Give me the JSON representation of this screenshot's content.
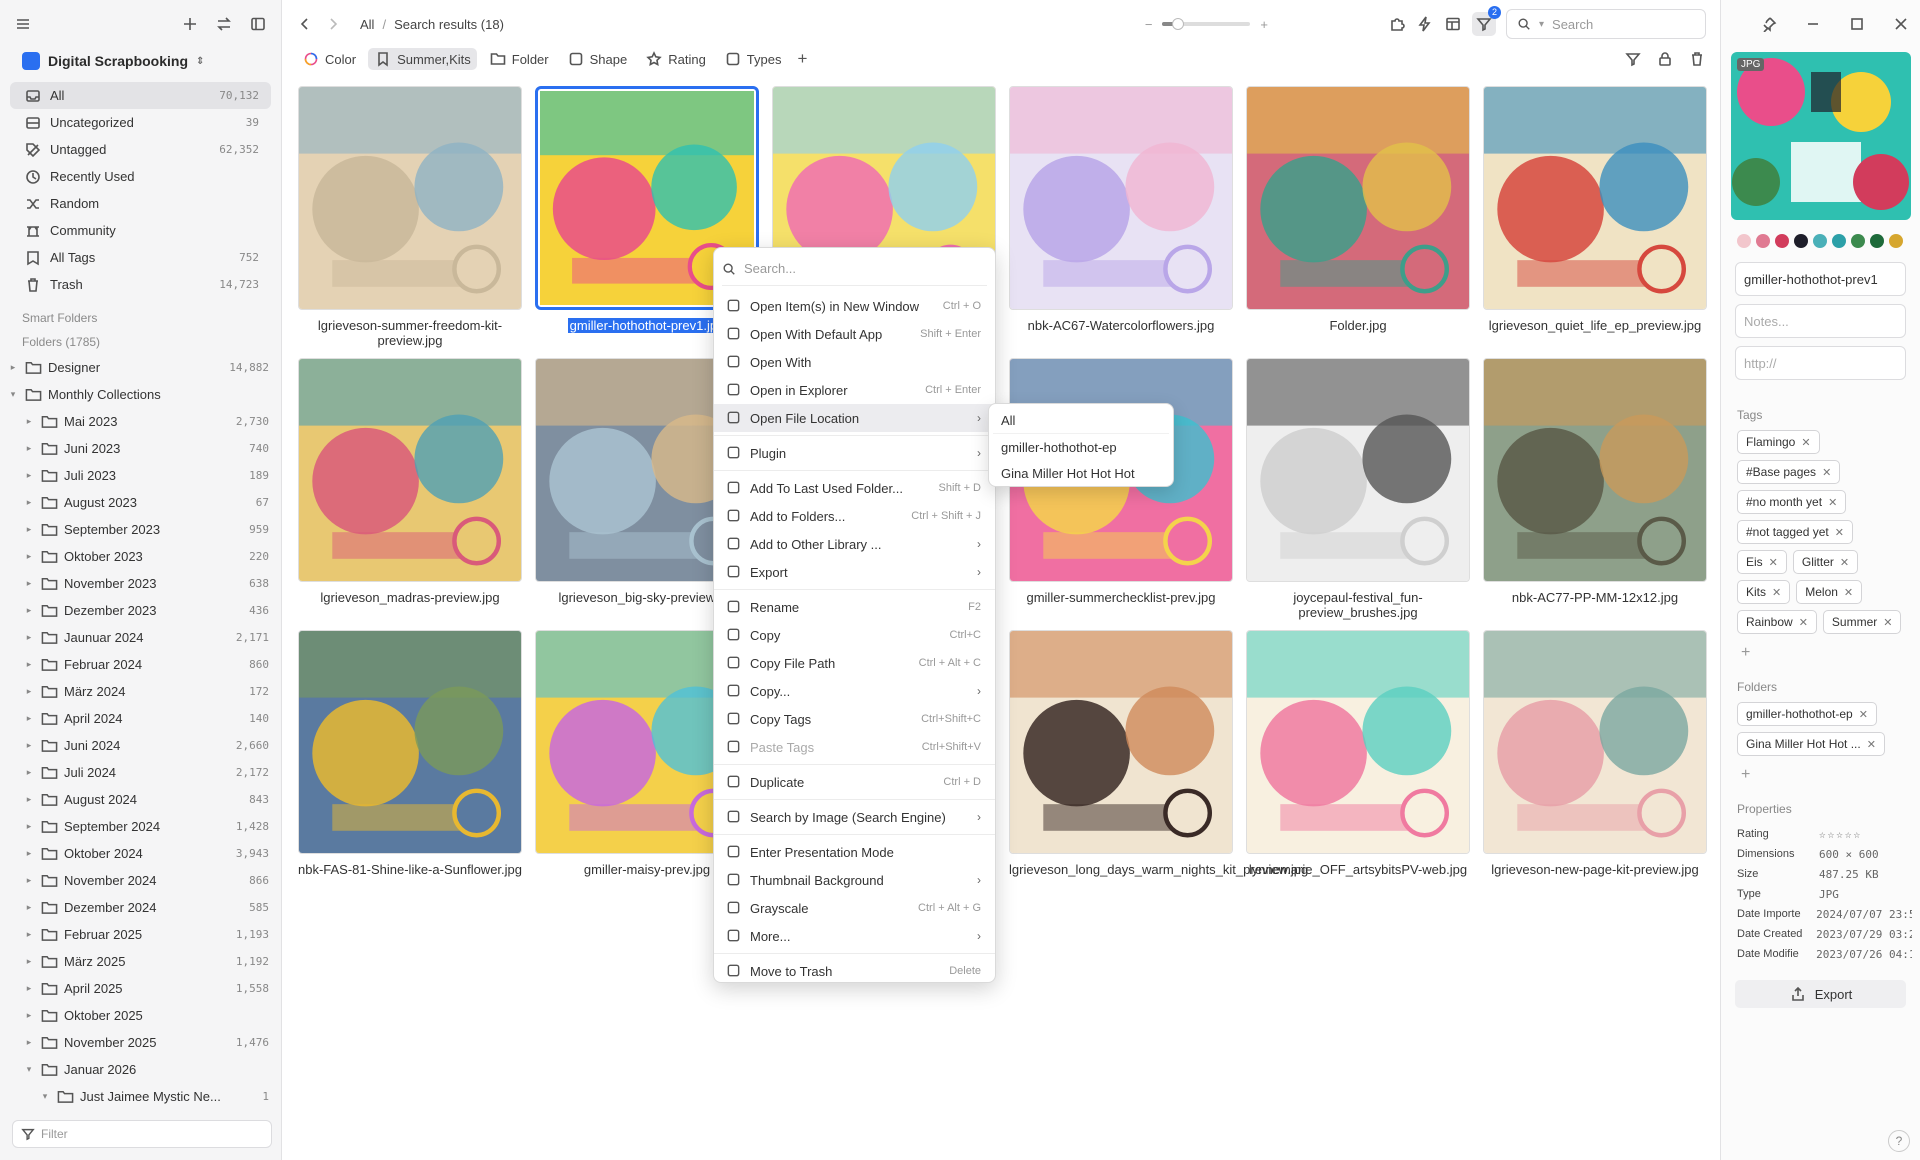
{
  "sidebar": {
    "library_name": "Digital Scrapbooking",
    "nav": [
      {
        "label": "All",
        "count": "70,132",
        "icon": "inbox-icon"
      },
      {
        "label": "Uncategorized",
        "count": "39",
        "icon": "uncategorized-icon"
      },
      {
        "label": "Untagged",
        "count": "62,352",
        "icon": "untagged-icon"
      },
      {
        "label": "Recently Used",
        "count": "",
        "icon": "clock-icon"
      },
      {
        "label": "Random",
        "count": "",
        "icon": "shuffle-icon"
      },
      {
        "label": "Community",
        "count": "",
        "icon": "community-icon"
      },
      {
        "label": "All Tags",
        "count": "752",
        "icon": "tag-icon"
      },
      {
        "label": "Trash",
        "count": "14,723",
        "icon": "trash-icon"
      }
    ],
    "smart_folders_label": "Smart Folders",
    "folders_label": "Folders (1785)",
    "folders": [
      {
        "label": "Designer",
        "count": "14,882",
        "depth": 0,
        "caret": "▸"
      },
      {
        "label": "Monthly Collections",
        "count": "",
        "depth": 0,
        "caret": "▾"
      },
      {
        "label": "Mai 2023",
        "count": "2,730",
        "depth": 1,
        "caret": "▸"
      },
      {
        "label": "Juni 2023",
        "count": "740",
        "depth": 1,
        "caret": "▸"
      },
      {
        "label": "Juli 2023",
        "count": "189",
        "depth": 1,
        "caret": "▸"
      },
      {
        "label": "August 2023",
        "count": "67",
        "depth": 1,
        "caret": "▸"
      },
      {
        "label": "September 2023",
        "count": "959",
        "depth": 1,
        "caret": "▸"
      },
      {
        "label": "Oktober 2023",
        "count": "220",
        "depth": 1,
        "caret": "▸"
      },
      {
        "label": "November 2023",
        "count": "638",
        "depth": 1,
        "caret": "▸"
      },
      {
        "label": "Dezember 2023",
        "count": "436",
        "depth": 1,
        "caret": "▸"
      },
      {
        "label": "Jaunuar 2024",
        "count": "2,171",
        "depth": 1,
        "caret": "▸"
      },
      {
        "label": "Februar 2024",
        "count": "860",
        "depth": 1,
        "caret": "▸"
      },
      {
        "label": "März 2024",
        "count": "172",
        "depth": 1,
        "caret": "▸"
      },
      {
        "label": "April 2024",
        "count": "140",
        "depth": 1,
        "caret": "▸"
      },
      {
        "label": "Juni 2024",
        "count": "2,660",
        "depth": 1,
        "caret": "▸"
      },
      {
        "label": "Juli 2024",
        "count": "2,172",
        "depth": 1,
        "caret": "▸"
      },
      {
        "label": "August 2024",
        "count": "843",
        "depth": 1,
        "caret": "▸"
      },
      {
        "label": "September 2024",
        "count": "1,428",
        "depth": 1,
        "caret": "▸"
      },
      {
        "label": "Oktober 2024",
        "count": "3,943",
        "depth": 1,
        "caret": "▸"
      },
      {
        "label": "November 2024",
        "count": "866",
        "depth": 1,
        "caret": "▸"
      },
      {
        "label": "Dezember 2024",
        "count": "585",
        "depth": 1,
        "caret": "▸"
      },
      {
        "label": "Februar 2025",
        "count": "1,193",
        "depth": 1,
        "caret": "▸"
      },
      {
        "label": "März 2025",
        "count": "1,192",
        "depth": 1,
        "caret": "▸"
      },
      {
        "label": "April 2025",
        "count": "1,558",
        "depth": 1,
        "caret": "▸"
      },
      {
        "label": "Oktober 2025",
        "count": "",
        "depth": 1,
        "caret": "▸"
      },
      {
        "label": "November 2025",
        "count": "1,476",
        "depth": 1,
        "caret": "▸"
      },
      {
        "label": "Januar 2026",
        "count": "",
        "depth": 1,
        "caret": "▾"
      },
      {
        "label": "Just Jaimee Mystic Ne...",
        "count": "1",
        "depth": 2,
        "caret": "▾"
      }
    ],
    "filter_placeholder": "Filter"
  },
  "toolbar": {
    "crumb_root": "All",
    "crumb_sep": "/",
    "crumb_current": "Search results (18)",
    "zoom_level": 0.18,
    "filter_badge": "2",
    "search_placeholder": "Search"
  },
  "filterbar": [
    {
      "label": "Color",
      "icon": "color-wheel-icon",
      "active": false
    },
    {
      "label": "Summer,Kits",
      "icon": "bookmark-icon",
      "active": true
    },
    {
      "label": "Folder",
      "icon": "folder-icon",
      "active": false
    },
    {
      "label": "Shape",
      "icon": "shape-icon",
      "active": false
    },
    {
      "label": "Rating",
      "icon": "star-icon",
      "active": false
    },
    {
      "label": "Types",
      "icon": "types-icon",
      "active": false
    }
  ],
  "grid": [
    {
      "name": "lgrieveson-summer-freedom-kit-preview.jpg",
      "c1": "#c9b89a",
      "c2": "#8fb3c4",
      "c3": "#e4d2b4"
    },
    {
      "name": "gmiller-hothothot-prev1.jpg",
      "c1": "#e94e8a",
      "c2": "#2fc0b0",
      "c3": "#f6d23a",
      "selected": true
    },
    {
      "name": "",
      "c1": "#f06fb0",
      "c2": "#8fd0f0",
      "c3": "#f5e06a"
    },
    {
      "name": "nbk-AC67-Watercolorflowers.jpg",
      "c1": "#b9a6e8",
      "c2": "#f0b5d2",
      "c3": "#e8e2f4"
    },
    {
      "name": "Folder.jpg",
      "c1": "#3e9e8a",
      "c2": "#e2c14a",
      "c3": "#d46a7a"
    },
    {
      "name": "lgrieveson_quiet_life_ep_preview.jpg",
      "c1": "#d6483e",
      "c2": "#3c8fbe",
      "c3": "#f0e3c4"
    },
    {
      "name": "lgrieveson_madras-preview.jpg",
      "c1": "#d95a7a",
      "c2": "#4fa0b4",
      "c3": "#e8c872"
    },
    {
      "name": "lgrieveson_big-sky-preview.jpg",
      "c1": "#a9c2d0",
      "c2": "#d9b98a",
      "c3": "#7f8fa0"
    },
    {
      "name": "",
      "c1": "#fff",
      "c2": "#fff",
      "c3": "#fff"
    },
    {
      "name": "gmiller-summerchecklist-prev.jpg",
      "c1": "#f4d34c",
      "c2": "#3cc0d0",
      "c3": "#f06fa2"
    },
    {
      "name": "joycepaul-festival_fun-preview_brushes.jpg",
      "c1": "#cfcfcf",
      "c2": "#555555",
      "c3": "#eeeeee"
    },
    {
      "name": "nbk-AC77-PP-MM-12x12.jpg",
      "c1": "#5a5a48",
      "c2": "#c99a5a",
      "c3": "#8ea08a"
    },
    {
      "name": "nbk-FAS-81-Shine-like-a-Sunflower.jpg",
      "c1": "#e8b830",
      "c2": "#7a9a5a",
      "c3": "#5a7aa0"
    },
    {
      "name": "gmiller-maisy-prev.jpg",
      "c1": "#c86adc",
      "c2": "#4fc0d8",
      "c3": "#f4d04a"
    },
    {
      "name": "",
      "c1": "#fff",
      "c2": "#fff",
      "c3": "#fff"
    },
    {
      "name": "lgrieveson_long_days_warm_nights_kit_preview.jpg",
      "c1": "#3a2a26",
      "c2": "#d08a5a",
      "c3": "#f0e4d0"
    },
    {
      "name": "lynnemarie_OFF_artsybitsPV-web.jpg",
      "c1": "#f07aa0",
      "c2": "#5ad0c0",
      "c3": "#f8f0e0"
    },
    {
      "name": "lgrieveson-new-page-kit-preview.jpg",
      "c1": "#e8a0a8",
      "c2": "#7aa8a0",
      "c3": "#f2e6d4"
    }
  ],
  "context_menu": {
    "search_placeholder": "Search...",
    "items": [
      {
        "label": "Open Item(s) in New Window",
        "sc": "Ctrl + O",
        "icon": "new-window-icon"
      },
      {
        "label": "Open With Default App",
        "sc": "Shift + Enter",
        "icon": "open-app-icon"
      },
      {
        "label": "Open With",
        "sc": "",
        "icon": "open-with-icon"
      },
      {
        "label": "Open in Explorer",
        "sc": "Ctrl + Enter",
        "icon": "explorer-icon"
      },
      {
        "label": "Open File Location",
        "sc": "",
        "icon": "folder-location-icon",
        "sub": true,
        "hover": true
      },
      {
        "sep": true
      },
      {
        "label": "Plugin",
        "sc": "",
        "icon": "plugin-icon",
        "sub": true
      },
      {
        "sep": true
      },
      {
        "label": "Add To Last Used Folder...",
        "sc": "Shift + D",
        "icon": "add-folder-icon"
      },
      {
        "label": "Add to Folders...",
        "sc": "Ctrl + Shift + J",
        "icon": "add-folders-icon"
      },
      {
        "label": "Add to Other Library ...",
        "sc": "",
        "icon": "library-icon",
        "sub": true
      },
      {
        "label": "Export",
        "sc": "",
        "icon": "export-icon",
        "sub": true
      },
      {
        "sep": true
      },
      {
        "label": "Rename",
        "sc": "F2",
        "icon": "rename-icon"
      },
      {
        "label": "Copy",
        "sc": "Ctrl+C",
        "icon": "copy-icon"
      },
      {
        "label": "Copy File Path",
        "sc": "Ctrl + Alt + C",
        "icon": "copy-path-icon"
      },
      {
        "label": "Copy...",
        "sc": "",
        "icon": "copy-more-icon",
        "sub": true
      },
      {
        "label": "Copy Tags",
        "sc": "Ctrl+Shift+C",
        "icon": "copy-tags-icon"
      },
      {
        "label": "Paste Tags",
        "sc": "Ctrl+Shift+V",
        "icon": "paste-tags-icon",
        "disabled": true
      },
      {
        "sep": true
      },
      {
        "label": "Duplicate",
        "sc": "Ctrl + D",
        "icon": "duplicate-icon"
      },
      {
        "sep": true
      },
      {
        "label": "Search by Image (Search Engine)",
        "sc": "",
        "icon": "image-search-icon",
        "sub": true
      },
      {
        "sep": true
      },
      {
        "label": "Enter Presentation Mode",
        "sc": "",
        "icon": "presentation-icon"
      },
      {
        "label": "Thumbnail Background",
        "sc": "",
        "icon": "thumbnail-bg-icon",
        "sub": true
      },
      {
        "label": "Grayscale",
        "sc": "Ctrl + Alt + G",
        "icon": "grayscale-icon"
      },
      {
        "label": "More...",
        "sc": "",
        "icon": "more-icon",
        "sub": true
      },
      {
        "sep": true
      },
      {
        "label": "Move to Trash",
        "sc": "Delete",
        "icon": "trash-icon"
      }
    ],
    "submenu": [
      "All",
      "gmiller-hothothot-ep",
      "Gina Miller Hot Hot Hot"
    ]
  },
  "inspector": {
    "type_badge": "JPG",
    "colors": [
      "#f2c6cc",
      "#e07a92",
      "#d23c5c",
      "#1e1e2a",
      "#4ab0b8",
      "#2ca0a8",
      "#3c8a4e",
      "#1e6a3a",
      "#d6a62e"
    ],
    "name": "gmiller-hothothot-prev1",
    "notes_placeholder": "Notes...",
    "url_placeholder": "http://",
    "tags_label": "Tags",
    "tags": [
      "Flamingo",
      "#Base pages",
      "#no month yet",
      "#not tagged yet",
      "Eis",
      "Glitter",
      "Kits",
      "Melon",
      "Rainbow",
      "Summer"
    ],
    "folders_label": "Folders",
    "folders": [
      "gmiller-hothothot-ep",
      "Gina Miller Hot Hot ..."
    ],
    "properties_label": "Properties",
    "props": [
      {
        "k": "Rating",
        "v": "☆☆☆☆☆"
      },
      {
        "k": "Dimensions",
        "v": "600 × 600"
      },
      {
        "k": "Size",
        "v": "487.25 KB"
      },
      {
        "k": "Type",
        "v": "JPG"
      },
      {
        "k": "Date Importe",
        "v": "2024/07/07 23:5"
      },
      {
        "k": "Date Created",
        "v": "2023/07/29 03:2"
      },
      {
        "k": "Date Modifie",
        "v": "2023/07/26 04:1"
      }
    ],
    "export_label": "Export",
    "help_label": "?"
  }
}
